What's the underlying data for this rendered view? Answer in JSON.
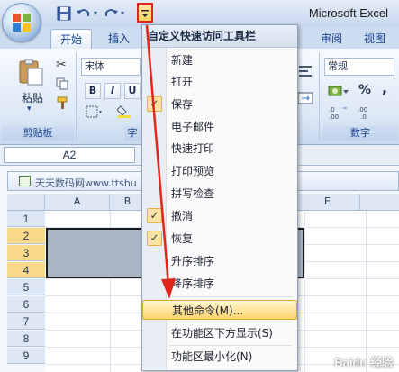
{
  "title_bar": {
    "app_title": "Microsoft Excel",
    "qat_dropdown_icon": "chevron-down-icon"
  },
  "ribbon": {
    "tabs": [
      {
        "label": "开始",
        "active": true
      },
      {
        "label": "插入",
        "active": false
      },
      {
        "label": "审阅",
        "active": false
      },
      {
        "label": "视图",
        "active": false
      }
    ],
    "clipboard": {
      "paste_label": "粘贴",
      "group_label": "剪贴板"
    },
    "font": {
      "font_name": "宋体",
      "bold": "B",
      "italic": "I",
      "underline": "U",
      "group_label": "字"
    },
    "number": {
      "format": "常规",
      "percent": "%",
      "comma": ",",
      "group_label": "数字"
    }
  },
  "formula_bar": {
    "name_box": "A2"
  },
  "workbook": {
    "title": "天天数码网www.ttshu",
    "columns": [
      "A",
      "B",
      "E"
    ],
    "rows": [
      "1",
      "2",
      "3",
      "4",
      "5",
      "6",
      "7",
      "8",
      "9"
    ],
    "selected_rows": [
      "2",
      "3",
      "4"
    ]
  },
  "qat_menu": {
    "header": "自定义快速访问工具栏",
    "items": [
      {
        "label": "新建",
        "checked": false
      },
      {
        "label": "打开",
        "checked": false
      },
      {
        "label": "保存",
        "checked": true
      },
      {
        "label": "电子邮件",
        "checked": false
      },
      {
        "label": "快速打印",
        "checked": false
      },
      {
        "label": "打印预览",
        "checked": false
      },
      {
        "label": "拼写检查",
        "checked": false
      },
      {
        "label": "撤消",
        "checked": true
      },
      {
        "label": "恢复",
        "checked": true
      },
      {
        "label": "升序排序",
        "checked": false
      },
      {
        "label": "降序排序",
        "checked": false
      }
    ],
    "more_commands": "其他命令(M)...",
    "show_below_ribbon": "在功能区下方显示(S)",
    "minimize_ribbon": "功能区最小化(N)"
  },
  "check_mark": "✓",
  "watermark": "Baidu 经验",
  "colors": {
    "annotation_red": "#e1261c",
    "highlight": "#ffd56b",
    "selection_fill": "#a9b5c4"
  }
}
